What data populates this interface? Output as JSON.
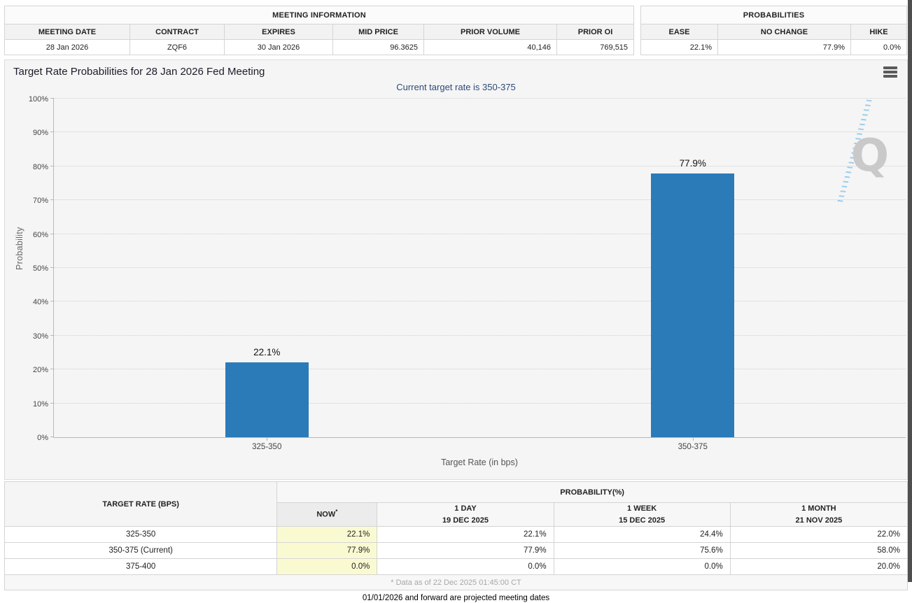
{
  "meeting_info": {
    "title": "MEETING INFORMATION",
    "columns": [
      "MEETING DATE",
      "CONTRACT",
      "EXPIRES",
      "MID PRICE",
      "PRIOR VOLUME",
      "PRIOR OI"
    ],
    "values": [
      "28 Jan 2026",
      "ZQF6",
      "30 Jan 2026",
      "96.3625",
      "40,146",
      "769,515"
    ]
  },
  "probabilities_box": {
    "title": "PROBABILITIES",
    "columns": [
      "EASE",
      "NO CHANGE",
      "HIKE"
    ],
    "values": [
      "22.1%",
      "77.9%",
      "0.0%"
    ]
  },
  "chart": {
    "title": "Target Rate Probabilities for 28 Jan 2026 Fed Meeting",
    "subtitle": "Current target rate is 350-375",
    "watermark_letter": "Q"
  },
  "chart_data": {
    "type": "bar",
    "title": "Target Rate Probabilities for 28 Jan 2026 Fed Meeting",
    "subtitle": "Current target rate is 350-375",
    "categories": [
      "325-350",
      "350-375"
    ],
    "values": [
      22.1,
      77.9
    ],
    "bar_labels": [
      "22.1%",
      "77.9%"
    ],
    "xlabel": "Target Rate (in bps)",
    "ylabel": "Probability",
    "ylim": [
      0,
      100
    ],
    "ytick_step": 10,
    "yticks": [
      "0%",
      "10%",
      "20%",
      "30%",
      "40%",
      "50%",
      "60%",
      "70%",
      "80%",
      "90%",
      "100%"
    ],
    "grid": "dotted horizontal",
    "bar_color": "#2b7bb9"
  },
  "history_table": {
    "rate_header": "TARGET RATE (BPS)",
    "group_header": "PROBABILITY(%)",
    "now_header": "NOW",
    "now_asterisk": "*",
    "period_headers": [
      [
        "1 DAY",
        "19 DEC 2025"
      ],
      [
        "1 WEEK",
        "15 DEC 2025"
      ],
      [
        "1 MONTH",
        "21 NOV 2025"
      ]
    ],
    "rows": [
      {
        "rate": "325-350",
        "now": "22.1%",
        "day": "22.1%",
        "week": "24.4%",
        "month": "22.0%"
      },
      {
        "rate": "350-375 (Current)",
        "now": "77.9%",
        "day": "77.9%",
        "week": "75.6%",
        "month": "58.0%"
      },
      {
        "rate": "375-400",
        "now": "0.0%",
        "day": "0.0%",
        "week": "0.0%",
        "month": "20.0%"
      }
    ],
    "footnote": "* Data as of 22 Dec 2025 01:45:00 CT"
  },
  "footer_note": "01/01/2026 and forward are projected meeting dates",
  "colors": {
    "bar": "#2b7bb9",
    "subtitle_text": "#2c4a78",
    "now_cell_bg": "#fafad2",
    "chart_bg": "#f5f5f5"
  }
}
